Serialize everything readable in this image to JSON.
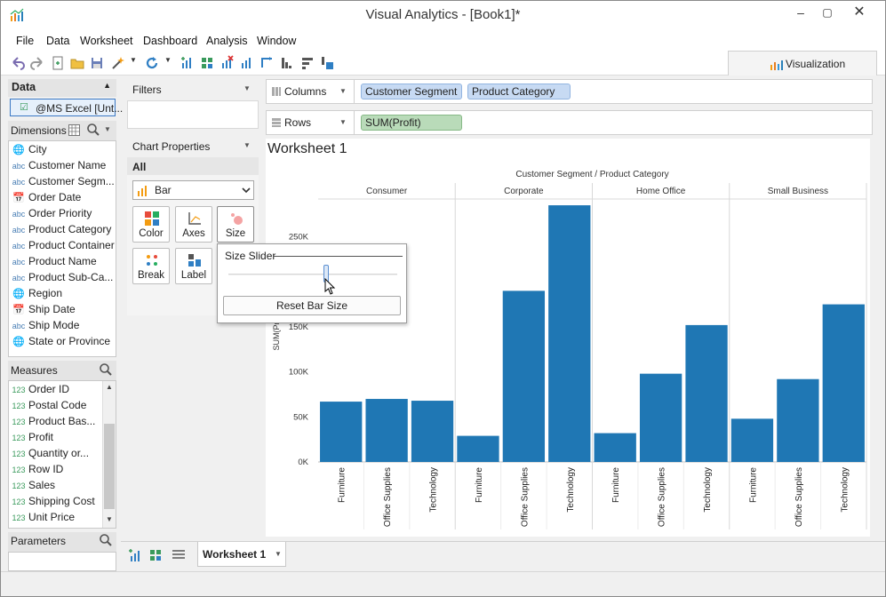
{
  "window": {
    "title": "Visual Analytics - [Book1]*"
  },
  "menu": [
    "File",
    "Data",
    "Worksheet",
    "Dashboard",
    "Analysis",
    "Window"
  ],
  "viz_tab": {
    "label": "Visualization"
  },
  "data_panel": {
    "header": "Data",
    "source": "@MS Excel [Unt...",
    "dimensions_label": "Dimensions",
    "dimensions": [
      {
        "type": "geo",
        "label": "City"
      },
      {
        "type": "abc",
        "label": "Customer Name"
      },
      {
        "type": "abc",
        "label": "Customer Segm..."
      },
      {
        "type": "date",
        "label": "Order Date"
      },
      {
        "type": "abc",
        "label": "Order Priority"
      },
      {
        "type": "abc",
        "label": "Product Category"
      },
      {
        "type": "abc",
        "label": "Product Container"
      },
      {
        "type": "abc",
        "label": "Product Name"
      },
      {
        "type": "abc",
        "label": "Product Sub-Ca..."
      },
      {
        "type": "geo",
        "label": "Region"
      },
      {
        "type": "date",
        "label": "Ship Date"
      },
      {
        "type": "abc",
        "label": "Ship Mode"
      },
      {
        "type": "geo",
        "label": "State or Province"
      }
    ],
    "measures_label": "Measures",
    "measures": [
      {
        "type": "123",
        "label": "Order ID"
      },
      {
        "type": "123",
        "label": "Postal Code"
      },
      {
        "type": "123",
        "label": "Product Bas..."
      },
      {
        "type": "123",
        "label": "Profit"
      },
      {
        "type": "123",
        "label": "Quantity or..."
      },
      {
        "type": "123",
        "label": "Row ID"
      },
      {
        "type": "123",
        "label": "Sales"
      },
      {
        "type": "123",
        "label": "Shipping Cost"
      },
      {
        "type": "123",
        "label": "Unit Price"
      }
    ],
    "parameters_label": "Parameters"
  },
  "filters": {
    "label": "Filters"
  },
  "chart_properties": {
    "label": "Chart Properties",
    "scope": "All",
    "mark_type": "Bar",
    "buttons": [
      "Color",
      "Axes",
      "Size",
      "Break",
      "Label"
    ]
  },
  "shelves": {
    "columns_label": "Columns",
    "columns": [
      "Customer Segment",
      "Product Category"
    ],
    "rows_label": "Rows",
    "rows": [
      "SUM(Profit)"
    ]
  },
  "size_popup": {
    "label": "Size Slider",
    "value": 0.58,
    "reset_label": "Reset Bar Size"
  },
  "worksheet": {
    "title": "Worksheet 1"
  },
  "sheet_tabs": {
    "active": "Worksheet 1"
  },
  "chart_data": {
    "type": "bar",
    "title": "Customer Segment / Product Category",
    "ylabel": "SUM(Profit)",
    "ylim": [
      0,
      290000
    ],
    "yticks": [
      {
        "v": 0,
        "label": "0K"
      },
      {
        "v": 50000,
        "label": "50K"
      },
      {
        "v": 100000,
        "label": "100K"
      },
      {
        "v": 150000,
        "label": "150K"
      },
      {
        "v": 250000,
        "label": "250K"
      }
    ],
    "groups": [
      {
        "name": "Consumer",
        "categories": [
          "Furniture",
          "Office Supplies",
          "Technology"
        ],
        "values": [
          67000,
          70000,
          68000
        ]
      },
      {
        "name": "Corporate",
        "categories": [
          "Furniture",
          "Office Supplies",
          "Technology"
        ],
        "values": [
          29000,
          190000,
          285000
        ]
      },
      {
        "name": "Home Office",
        "categories": [
          "Furniture",
          "Office Supplies",
          "Technology"
        ],
        "values": [
          32000,
          98000,
          152000
        ]
      },
      {
        "name": "Small Business",
        "categories": [
          "Furniture",
          "Office Supplies",
          "Technology"
        ],
        "values": [
          48000,
          92000,
          175000
        ]
      }
    ],
    "color": "#1f77b4"
  }
}
